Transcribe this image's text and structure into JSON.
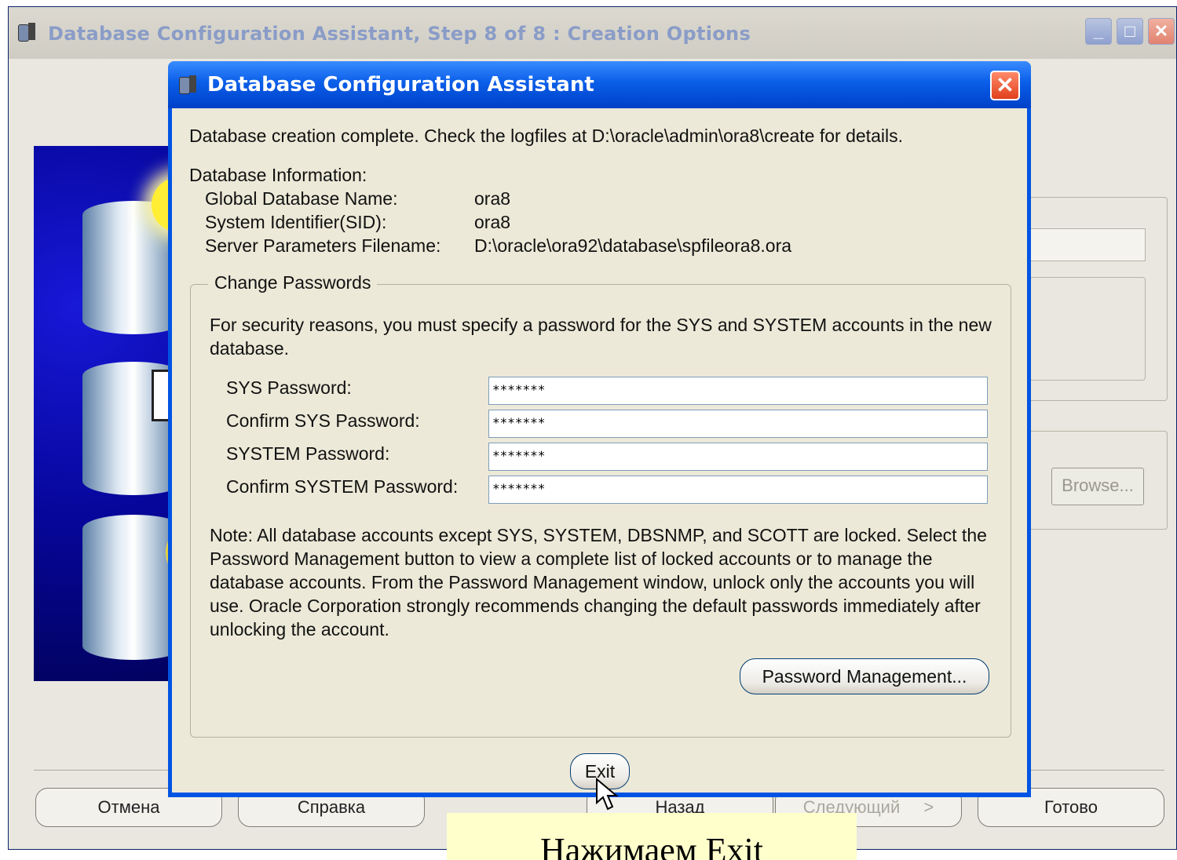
{
  "outer_window": {
    "title": "Database Configuration Assistant, Step 8 of 8 : Creation Options",
    "controls": [
      "minimize-icon",
      "maximize-icon",
      "close-icon"
    ],
    "browse_label": "Browse...",
    "nav": {
      "cancel": "Отмена",
      "help": "Справка",
      "back": "Назад",
      "next": "Следующий",
      "next_arrow": ">",
      "finish": "Готово"
    }
  },
  "dialog": {
    "title": "Database Configuration Assistant",
    "close_glyph": "✕",
    "message": "Database creation complete. Check the logfiles at D:\\oracle\\admin\\ora8\\create for details.",
    "info_heading": "Database Information:",
    "info": [
      {
        "label": "Global Database Name:",
        "value": "ora8"
      },
      {
        "label": "System Identifier(SID):",
        "value": "ora8"
      },
      {
        "label": "Server Parameters Filename:",
        "value": "D:\\oracle\\ora92\\database\\spfileora8.ora"
      }
    ],
    "change_passwords": {
      "legend": "Change Passwords",
      "intro": "For security reasons, you must specify a password for the SYS and SYSTEM accounts in the new database.",
      "fields": [
        {
          "label": "SYS Password:",
          "value": "*******"
        },
        {
          "label": "Confirm SYS Password:",
          "value": "*******"
        },
        {
          "label": "SYSTEM Password:",
          "value": "*******"
        },
        {
          "label": "Confirm SYSTEM Password:",
          "value": "*******"
        }
      ],
      "note": "Note: All database accounts except SYS, SYSTEM, DBSNMP, and SCOTT are locked. Select the Password Management button to view a complete list of locked accounts or to manage the database accounts. From the Password Management window, unlock only the accounts you will use. Oracle Corporation strongly recommends changing the default passwords immediately after unlocking the account.",
      "password_management_label": "Password Management..."
    },
    "exit_label": "Exit"
  },
  "caption": "Нажимаем Exit",
  "colors": {
    "dialog_title": "#0054e3",
    "dialog_body": "#ece9d8",
    "caption_bg": "#ffffcc"
  }
}
